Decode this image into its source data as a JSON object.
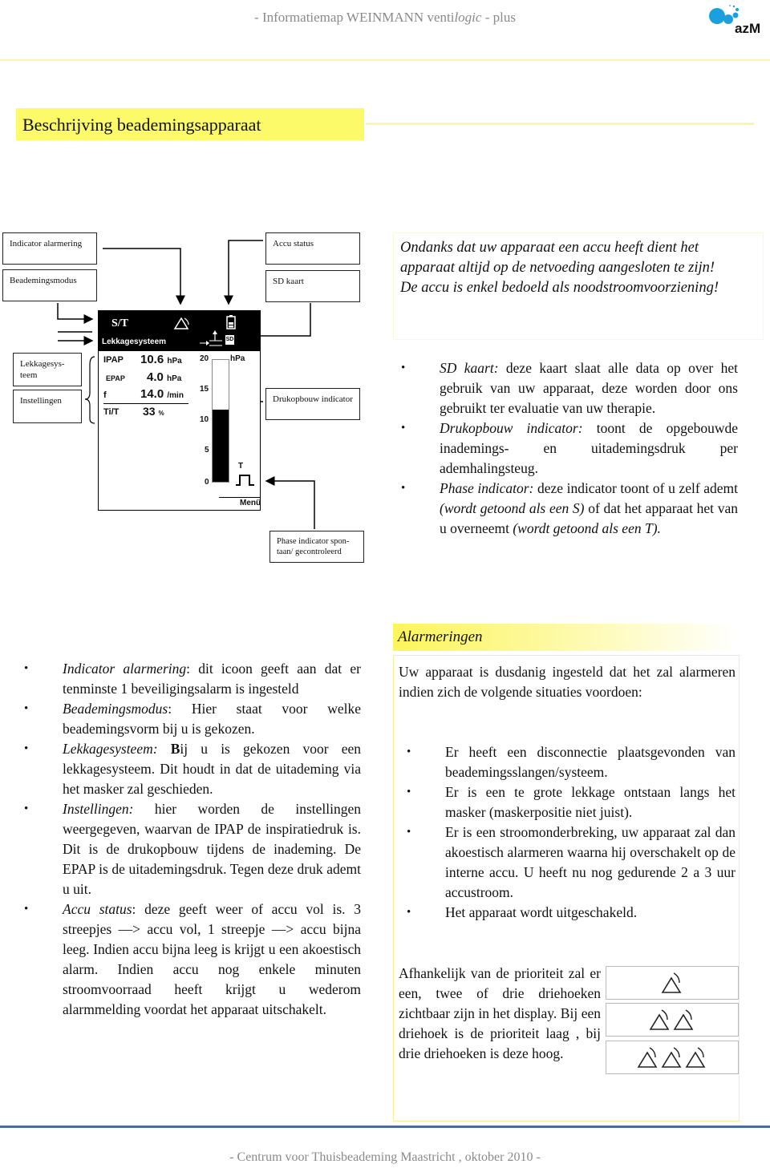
{
  "header": {
    "title_prefix": "- Informatiemap WEINMANN venti",
    "title_italic": "logic",
    "title_suffix": " - plus",
    "logo_text": "azM"
  },
  "section_title": "Beschrijving beademingsapparaat",
  "diagram": {
    "labels": {
      "indicator_alarmering": "Indicator  alarmering",
      "beademingsmodus": "Beademingsmodus",
      "lekkagesysteem": "Lekkagesys-teem",
      "instellingen": "Instellingen",
      "accu_status": "Accu status",
      "sd_kaart": "SD kaart",
      "drukopbouw": "Drukopbouw indicator",
      "phase": "Phase indicator  spon-taan/ gecontroleerd"
    },
    "display": {
      "mode": "S/T",
      "system": "Lekkagesysteem",
      "sd_label": "SD",
      "settings": [
        {
          "name": "IPAP",
          "value": "10.6",
          "unit": "hPa"
        },
        {
          "name": "EPAP",
          "value": "4.0",
          "unit": "hPa"
        },
        {
          "name": "f",
          "value": "14.0",
          "unit": "/min"
        },
        {
          "name": "Ti/T",
          "value": "33",
          "unit": "%"
        }
      ],
      "pressure_unit": "hPa",
      "pressure_scale": [
        "20",
        "15",
        "10",
        "5",
        "0"
      ],
      "pressure_max": 20,
      "pressure_value": 11.8,
      "phase_label": "T",
      "menu_label": "Menü"
    }
  },
  "note": {
    "line1": "Ondanks dat uw apparaat een accu heeft dient het apparaat altijd op de netvoeding aangesloten te zijn!",
    "line2": "De accu is enkel bedoeld als noodstroomvoorziening!"
  },
  "right_bullets": [
    {
      "term": "SD kaart:",
      "text": " deze kaart slaat alle data op over het gebruik van uw apparaat, deze worden door ons gebruikt ter evaluatie van uw therapie."
    },
    {
      "term": "Drukopbouw indicator:",
      "text": " toont de opgebouwde inademings- en uitademingsdruk per ademhalingsteug."
    },
    {
      "term": "Phase indicator:",
      "text": " deze indicator toont of u zelf ademt ",
      "italic2": "(wordt getoond als een S)",
      "text2": " of dat het apparaat het van u overneemt ",
      "italic3": "(wordt getoond als een T)."
    }
  ],
  "left_bullets": [
    {
      "term": "Indicator alarmering",
      "text": ": dit icoon geeft aan dat er tenminste 1 beveiligingsalarm is ingesteld"
    },
    {
      "term": "Beademingsmodus",
      "text": ": Hier staat voor welke beademingsvorm bij u is gekozen."
    },
    {
      "term": "Lekkagesysteem:",
      "bold": " B",
      "text": "ij u is gekozen voor een lekkagesysteem. Dit houdt in dat de uitademing via het masker zal geschieden."
    },
    {
      "term": "Instellingen:",
      "text": " hier worden de instellingen weergegeven, waarvan de IPAP de inspiratiedruk is. Dit is de drukopbouw tijdens de inademing. De EPAP is de uitademingsdruk. Tegen deze druk ademt u uit."
    },
    {
      "term": "Accu status",
      "text": ": deze geeft weer of accu vol is. 3 streepjes —> accu vol,  1 streepje —> accu bijna leeg. Indien accu bijna leeg is krijgt u een akoestisch alarm. Indien accu nog enkele minuten stroomvoorraad heeft krijgt u wederom alarmmelding voordat het apparaat uitschakelt."
    }
  ],
  "alarm": {
    "heading": "Alarmeringen",
    "intro": "Uw apparaat is dusdanig ingesteld dat het zal alarmeren indien zich de volgende situaties voordoen:",
    "items": [
      "Er heeft een disconnectie plaatsgevonden van beademingsslangen/systeem.",
      "Er is een te grote lekkage ontstaan langs het masker (maskerpositie niet juist).",
      "Er is een stroomonderbreking, uw apparaat zal dan akoestisch alarmeren waarna hij overschakelt op de interne accu. U heeft nu nog gedurende 2 a 3 uur accustroom.",
      "Het apparaat wordt uitgeschakeld."
    ],
    "priority_text": "Afhankelijk van de prioriteit zal er een, twee of drie driehoeken zichtbaar zijn in het display. Bij een driehoek is de prioriteit laag , bij drie driehoeken is deze hoog.",
    "priority_levels": [
      1,
      2,
      3
    ]
  },
  "footer": "- Centrum voor Thuisbeademing Maastricht ,  oktober 2010 -"
}
